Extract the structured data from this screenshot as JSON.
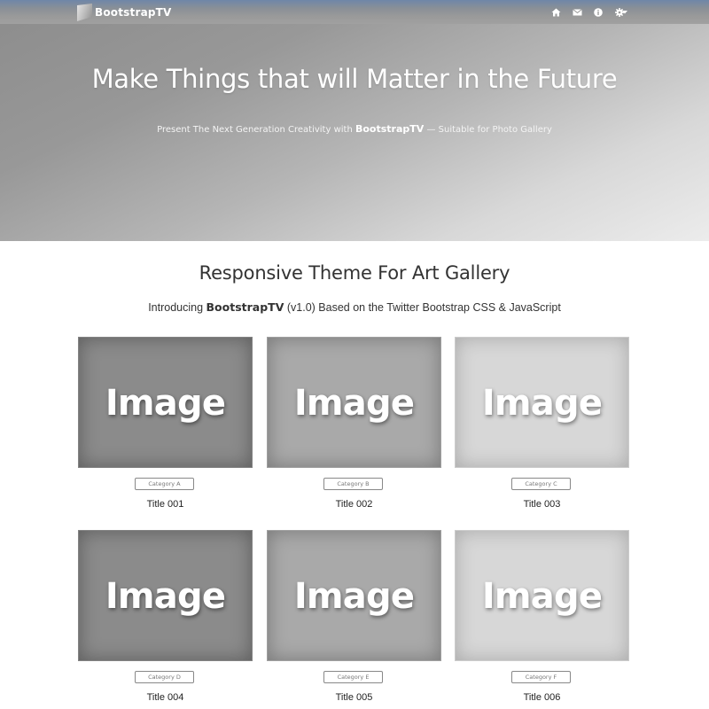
{
  "navbar": {
    "brand": "BootstrapTV",
    "icons": [
      "home-icon",
      "envelope-icon",
      "info-icon",
      "gear-icon"
    ]
  },
  "hero": {
    "title": "Make Things that will Matter in the Future",
    "subtitle_before": "Present The Next Generation Creativity with",
    "subtitle_brand": "BootstrapTV",
    "subtitle_after": "— Suitable for Photo Gallery"
  },
  "section": {
    "title": "Responsive Theme For Art Gallery",
    "subtitle_before": "Introducing",
    "subtitle_brand": "BootstrapTV",
    "subtitle_after": "(v1.0) Based on the Twitter Bootstrap CSS & JavaScript"
  },
  "gallery": {
    "items": [
      {
        "image_label": "Image",
        "category": "Category A",
        "title": "Title 001"
      },
      {
        "image_label": "Image",
        "category": "Category B",
        "title": "Title 002"
      },
      {
        "image_label": "Image",
        "category": "Category C",
        "title": "Title 003"
      },
      {
        "image_label": "Image",
        "category": "Category D",
        "title": "Title 004"
      },
      {
        "image_label": "Image",
        "category": "Category E",
        "title": "Title 005"
      },
      {
        "image_label": "Image",
        "category": "Category F",
        "title": "Title 006"
      }
    ]
  },
  "colors": {
    "navbar_top": "#6f86a8",
    "hero_dark": "#8c8c8c",
    "hero_light": "#ececec",
    "thumb_dark": "#8b8b8b",
    "thumb_mid": "#a9a9a9",
    "thumb_light": "#d7d7d7"
  }
}
